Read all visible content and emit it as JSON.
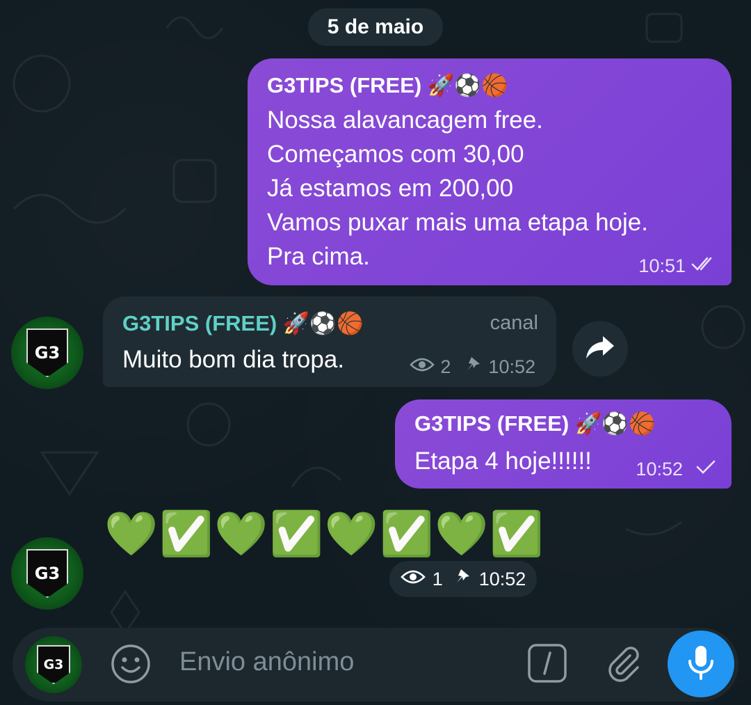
{
  "date_separator": "5 de maio",
  "messages": [
    {
      "sender": "G3TIPS (FREE) 🚀⚽🏀",
      "lines": [
        "Nossa alavancagem free.",
        "Começamos com 30,00",
        "Já estamos em 200,00",
        "Vamos puxar mais uma etapa hoje.",
        "Pra cima."
      ],
      "time": "10:51",
      "status_icon": "double-check-icon"
    },
    {
      "sender": "G3TIPS (FREE) 🚀⚽🏀",
      "badge": "canal",
      "text": "Muito bom dia tropa.",
      "views": "2",
      "time": "10:52"
    },
    {
      "sender": "G3TIPS (FREE) 🚀⚽🏀",
      "text": "Etapa 4 hoje!!!!!!",
      "time": "10:52",
      "status_icon": "single-check-icon"
    },
    {
      "emojis": "💚✅💚✅💚✅💚✅",
      "views": "1",
      "time": "10:52"
    }
  ],
  "avatar_label": "G3",
  "composer": {
    "placeholder": "Envio anônimo"
  },
  "colors": {
    "background": "#111c22",
    "outgoing_bubble": "#8446d6",
    "incoming_bubble": "#1f2c34",
    "sender_incoming": "#5fd1c6",
    "mic_button": "#2196f3"
  }
}
